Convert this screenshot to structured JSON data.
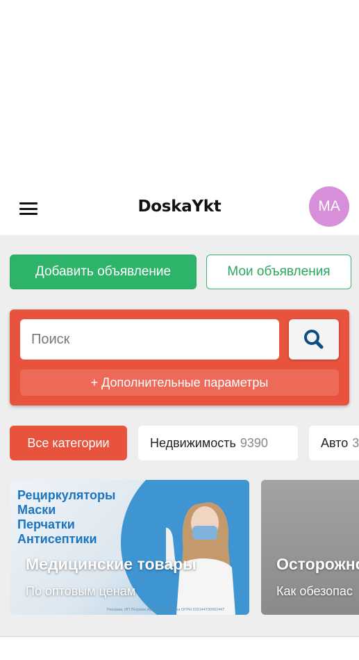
{
  "header": {
    "logo": "DoskaYkt",
    "avatar_initials": "MA",
    "avatar_color": "#d68fd8"
  },
  "actions": {
    "add_label": "Добавить объявление",
    "mine_label": "Мои объявления"
  },
  "search": {
    "placeholder": "Поиск",
    "more_label": "+ Дополнительные параметры",
    "icon": "search-icon"
  },
  "categories": [
    {
      "label": "Все категории",
      "count": ""
    },
    {
      "label": "Недвижимость",
      "count": "9390"
    },
    {
      "label": "Авто",
      "count": "3"
    }
  ],
  "banners": [
    {
      "items": [
        "Рециркуляторы",
        "Маски",
        "Перчатки",
        "Антисептики"
      ],
      "title": "Медицинские товары",
      "subtitle": "По оптовым ценам",
      "legal": "Реклама, ИП Петрова Ирина Алексеевна ОГРН 319144700062447"
    },
    {
      "title": "Осторожно",
      "subtitle": "Как обезопас"
    }
  ],
  "colors": {
    "accent_green": "#2eb36a",
    "accent_red": "#e8533e",
    "background": "#eeeeee"
  }
}
